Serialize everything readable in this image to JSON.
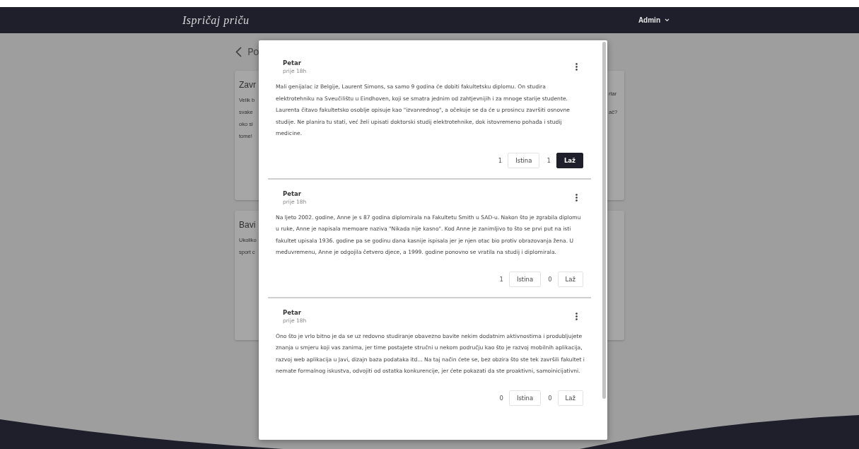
{
  "header": {
    "logo": "Ispričaj priču",
    "user_menu": "Admin"
  },
  "page": {
    "back_link": "Po",
    "cards": [
      {
        "title": "Zavr",
        "left_lines": [
          "Velik b",
          "svake",
          "oko si",
          "tome!"
        ],
        "right_lines": [
          "rtar",
          "ač?"
        ]
      },
      {
        "title": "Bavi",
        "left_lines": [
          "Ukoliko",
          "sport c"
        ]
      }
    ]
  },
  "modal": {
    "posts": [
      {
        "author": "Petar",
        "time": "prije 18h",
        "text": "Mali genijalac iz Belgije, Laurent Simons, sa samo 9 godina će dobiti fakultetsku diplomu. On studira elektrotehniku na Sveučilištu u  Eindhoven, koji se smatra jednim od zahtjevnijih i za mnoge starije studente. Laurenta čitavo fakultetsko osoblje opisuje kao \"izvanrednog\", a očekuje se da će u prosincu završiti osnovne studije. Ne planira tu stati, već želi upisati doktorski studij elektrotehnike, dok istovremeno pohađa i studij medicine.",
        "votes": [
          {
            "count": "1",
            "label": "Istina",
            "selected": false
          },
          {
            "count": "1",
            "label": "Laž",
            "selected": true
          }
        ]
      },
      {
        "author": "Petar",
        "time": "prije 18h",
        "text": "Na ljeto 2002. godine, Anne je s 87 godina diplomirala na Fakultetu Smith u SAD-u. Nakon što je zgrabila diplomu u ruke, Anne je napisala memoare naziva \"Nikada nije kasno\". Kod Anne je zanimljivo to što se prvi put na isti fakultet upisala 1936. godine pa se godinu dana kasnije ispisala jer je njen otac bio protiv obrazovanja žena. U međuvremenu, Anne je odgojila četvero djece, a 1999. godine ponovno se vratila na studij i diplomirala.",
        "votes": [
          {
            "count": "1",
            "label": "Istina",
            "selected": false
          },
          {
            "count": "0",
            "label": "Laž",
            "selected": false
          }
        ]
      },
      {
        "author": "Petar",
        "time": "prije 18h",
        "text": "Ono što je vrlo bitno je da se uz redovno studiranje obavezno bavite nekim dodatnim aktivnostima i produbljujete znanja u smjeru koji vas zanima, jer time postajete stručni u nekom području kao što je razvoj mobilnih aplikacija, razvoj web aplikacija u Javi, dizajn baza podataka itd... Na taj način ćete se, bez obzira što ste tek završili fakultet i nemate formalnog iskustva, odvojiti od ostatka konkurencije, jer ćete pokazati da ste proaktivni, samoinicijativni.",
        "votes": [
          {
            "count": "0",
            "label": "Istina",
            "selected": false
          },
          {
            "count": "0",
            "label": "Laž",
            "selected": false
          }
        ]
      }
    ]
  }
}
